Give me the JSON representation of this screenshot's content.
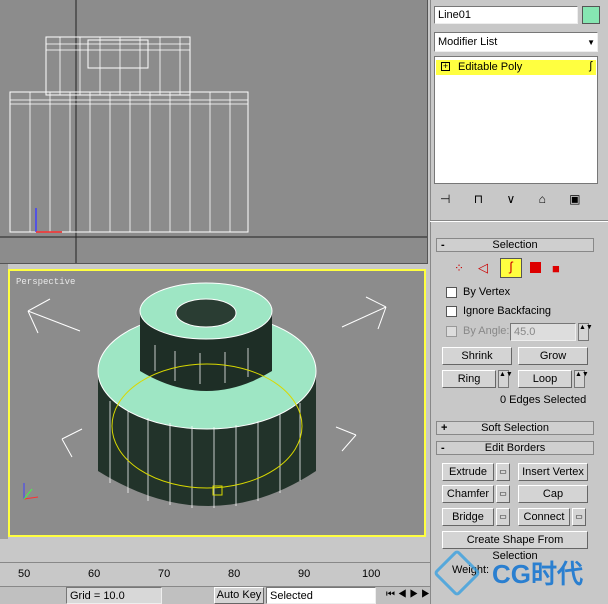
{
  "viewports": {
    "front_label": "",
    "persp_label": "Perspective"
  },
  "panel": {
    "object_name": "Line01",
    "object_color": "#86e6b2",
    "modifier_list": "Modifier List",
    "stack_item": "Editable Poly",
    "selection": {
      "title": "Selection",
      "by_vertex": "By Vertex",
      "ignore_backfacing": "Ignore Backfacing",
      "by_angle": "By Angle:",
      "angle_value": "45.0",
      "shrink": "Shrink",
      "grow": "Grow",
      "ring": "Ring",
      "loop": "Loop",
      "status": "0 Edges Selected"
    },
    "soft_selection": "Soft Selection",
    "edit_borders": {
      "title": "Edit Borders",
      "extrude": "Extrude",
      "insert_vertex": "Insert Vertex",
      "chamfer": "Chamfer",
      "cap": "Cap",
      "bridge": "Bridge",
      "connect": "Connect",
      "create_shape": "Create Shape From Selection",
      "weight": "Weight:"
    }
  },
  "timeline": {
    "ticks": [
      "50",
      "60",
      "70",
      "80",
      "90",
      "100"
    ]
  },
  "status": {
    "grid": "Grid = 10.0",
    "auto_key": "Auto Key",
    "selected": "Selected"
  },
  "watermark": "CG时代"
}
